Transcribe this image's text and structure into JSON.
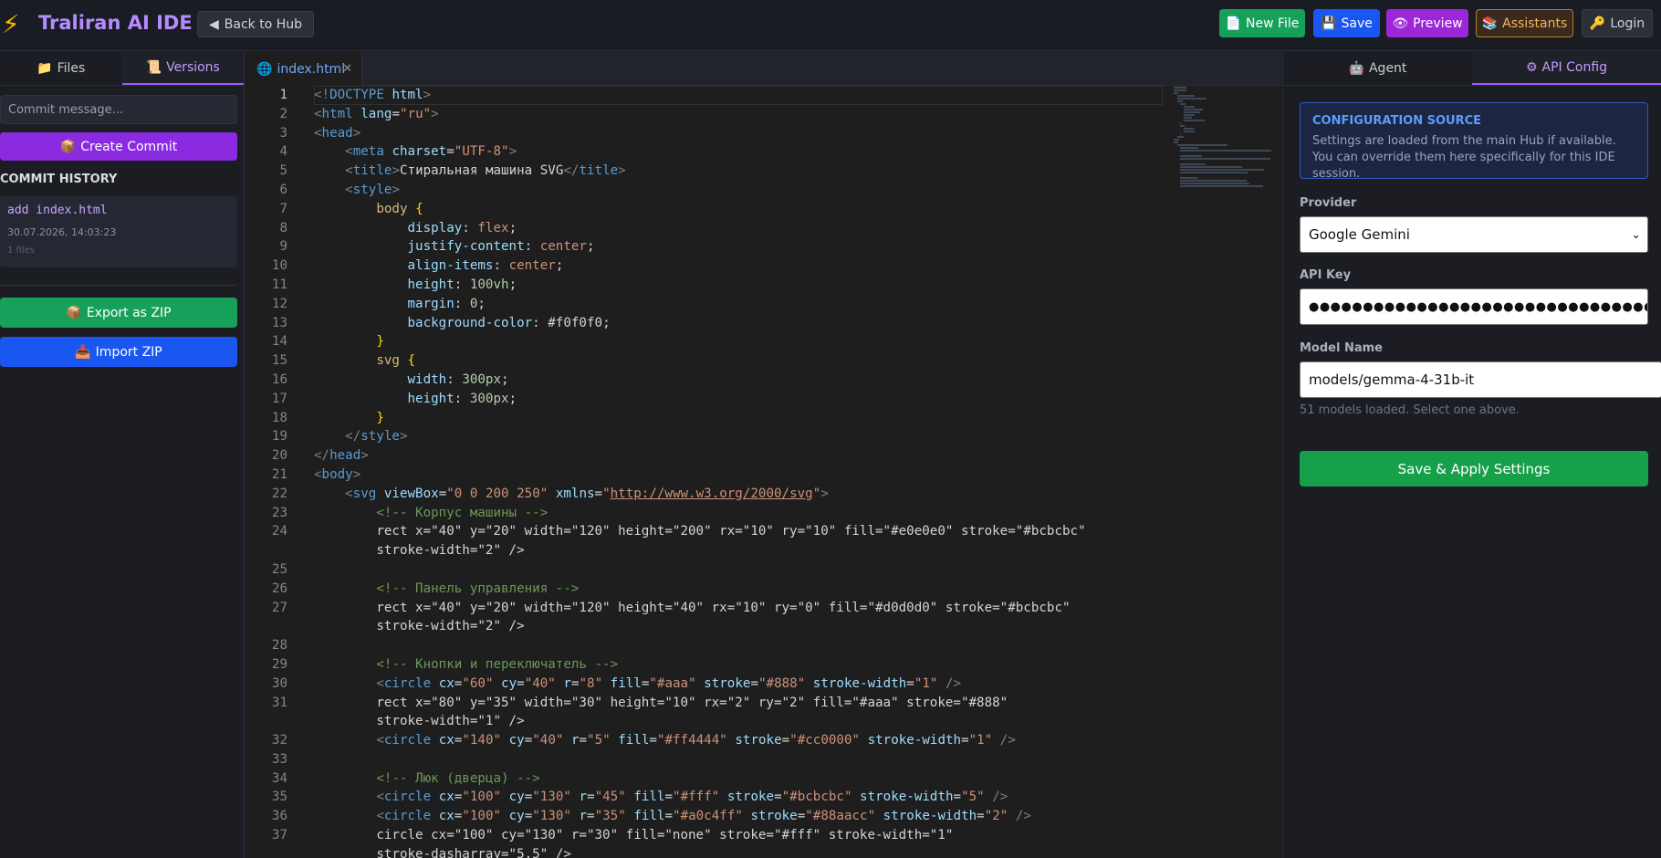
{
  "header": {
    "logo_icon": "⚡",
    "title": "Traliran AI IDE",
    "back_label": "Back to Hub",
    "buttons": {
      "new_file": "New File",
      "save": "Save",
      "preview": "Preview",
      "assistants": "Assistants",
      "login": "Login"
    }
  },
  "left_panel": {
    "tabs": {
      "files": "Files",
      "versions": "Versions"
    },
    "commit_placeholder": "Commit message...",
    "create_commit": "Create Commit",
    "history_title": "COMMIT HISTORY",
    "commits": [
      {
        "message": "add index.html",
        "date": "30.07.2026, 14:03:23",
        "files": "1 files"
      }
    ],
    "export_zip": "Export as ZIP",
    "import_zip": "Import ZIP"
  },
  "editor": {
    "tab_name": "index.html",
    "code_lines": [
      "<!DOCTYPE html>",
      "<html lang=\"ru\">",
      "<head>",
      "    <meta charset=\"UTF-8\">",
      "    <title>Стиральная машина SVG</title>",
      "    <style>",
      "        body {",
      "            display: flex;",
      "            justify-content: center;",
      "            align-items: center;",
      "            height: 100vh;",
      "            margin: 0;",
      "            background-color: #f0f0f0;",
      "        }",
      "        svg {",
      "            width: 300px;",
      "            height: 300px;",
      "        }",
      "    </style>",
      "</head>",
      "<body>",
      "    <svg viewBox=\"0 0 200 250\" xmlns=\"http://www.w3.org/2000/svg\">",
      "        <!-- Корпус машины -->",
      "        <rect x=\"40\" y=\"20\" width=\"120\" height=\"200\" rx=\"10\" ry=\"10\" fill=\"#e0e0e0\" stroke=\"#bcbcbc\" stroke-width=\"2\" />",
      "",
      "        <!-- Панель управления -->",
      "        <rect x=\"40\" y=\"20\" width=\"120\" height=\"40\" rx=\"10\" ry=\"0\" fill=\"#d0d0d0\" stroke=\"#bcbcbc\" stroke-width=\"2\" />",
      "",
      "        <!-- Кнопки и переключатель -->",
      "        <circle cx=\"60\" cy=\"40\" r=\"8\" fill=\"#aaa\" stroke=\"#888\" stroke-width=\"1\" />",
      "        <rect x=\"80\" y=\"35\" width=\"30\" height=\"10\" rx=\"2\" ry=\"2\" fill=\"#aaa\" stroke=\"#888\" stroke-width=\"1\" />",
      "        <circle cx=\"140\" cy=\"40\" r=\"5\" fill=\"#ff4444\" stroke=\"#cc0000\" stroke-width=\"1\" />",
      "",
      "        <!-- Люк (дверца) -->",
      "        <circle cx=\"100\" cy=\"130\" r=\"45\" fill=\"#fff\" stroke=\"#bcbcbc\" stroke-width=\"5\" />",
      "        <circle cx=\"100\" cy=\"130\" r=\"35\" fill=\"#a0c4ff\" stroke=\"#88aacc\" stroke-width=\"2\" />",
      "        <circle cx=\"100\" cy=\"130\" r=\"30\" fill=\"none\" stroke=\"#fff\" stroke-width=\"1\" stroke-dasharray=\"5,5\" />"
    ]
  },
  "right_panel": {
    "tabs": {
      "agent": "Agent",
      "api_config": "API Config"
    },
    "config_title": "CONFIGURATION SOURCE",
    "config_text": "Settings are loaded from the main Hub if available. You can override them here specifically for this IDE session.",
    "provider_label": "Provider",
    "provider_value": "Google Gemini",
    "api_key_label": "API Key",
    "api_key_value": "●●●●●●●●●●●●●●●●●●●●●●●●●●●●●●●●●●●●●●●",
    "model_label": "Model Name",
    "model_value": "models/gemma-4-31b-it",
    "hint": "51 models loaded. Select one above.",
    "save_apply": "Save & Apply Settings"
  }
}
